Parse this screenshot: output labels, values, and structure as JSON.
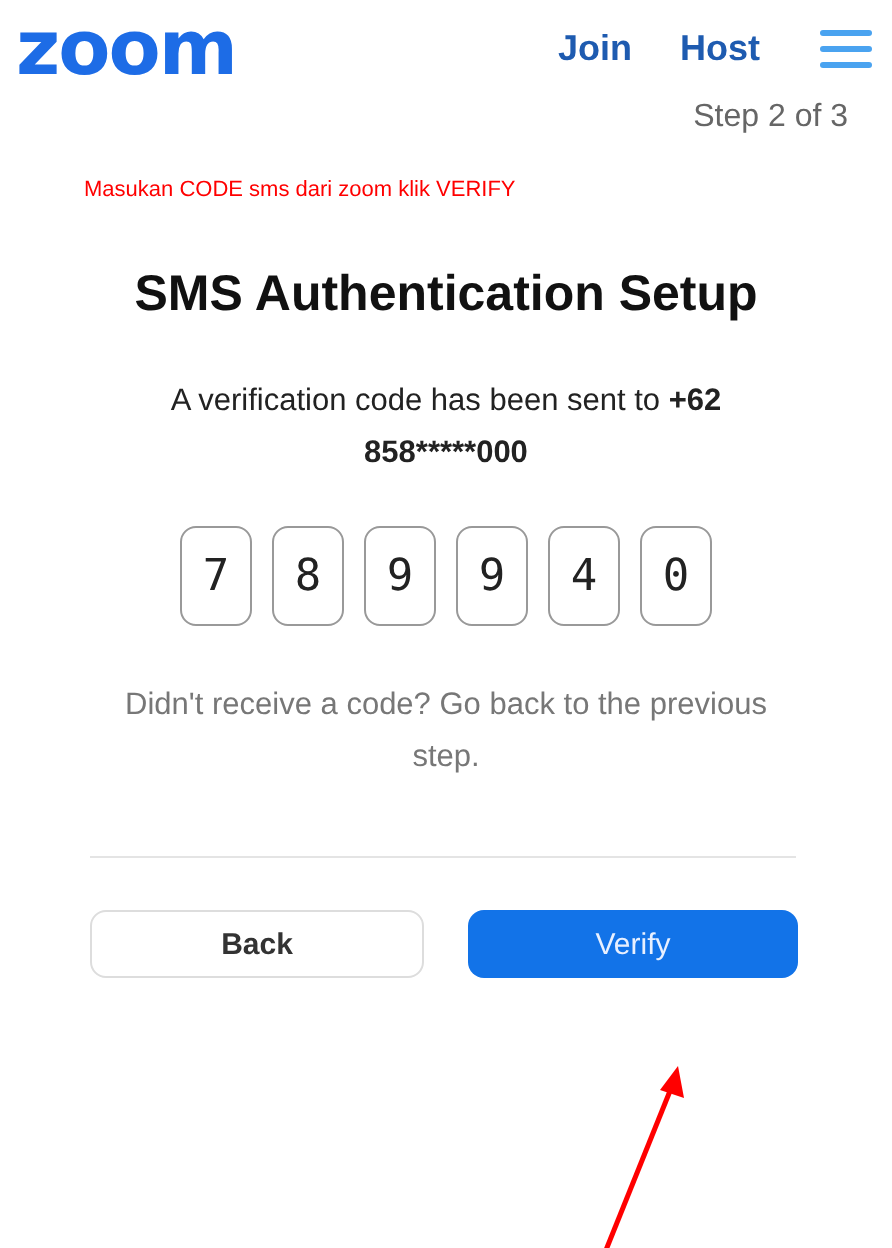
{
  "header": {
    "logo": "zoom",
    "nav": [
      "Join",
      "Host"
    ],
    "step": "Step 2 of 3"
  },
  "annotation": {
    "note": "Masukan CODE sms dari zoom klik VERIFY"
  },
  "title": "SMS Authentication Setup",
  "message": {
    "text": "A verification code has been sent to",
    "phone": "+62 858*****000"
  },
  "code_digits": [
    "7",
    "8",
    "9",
    "9",
    "4",
    "0"
  ],
  "hint": "Didn't receive a code? Go back to the previous step.",
  "buttons": [
    {
      "label": "Back",
      "kind": "secondary"
    },
    {
      "label": "Verify",
      "kind": "primary"
    }
  ]
}
